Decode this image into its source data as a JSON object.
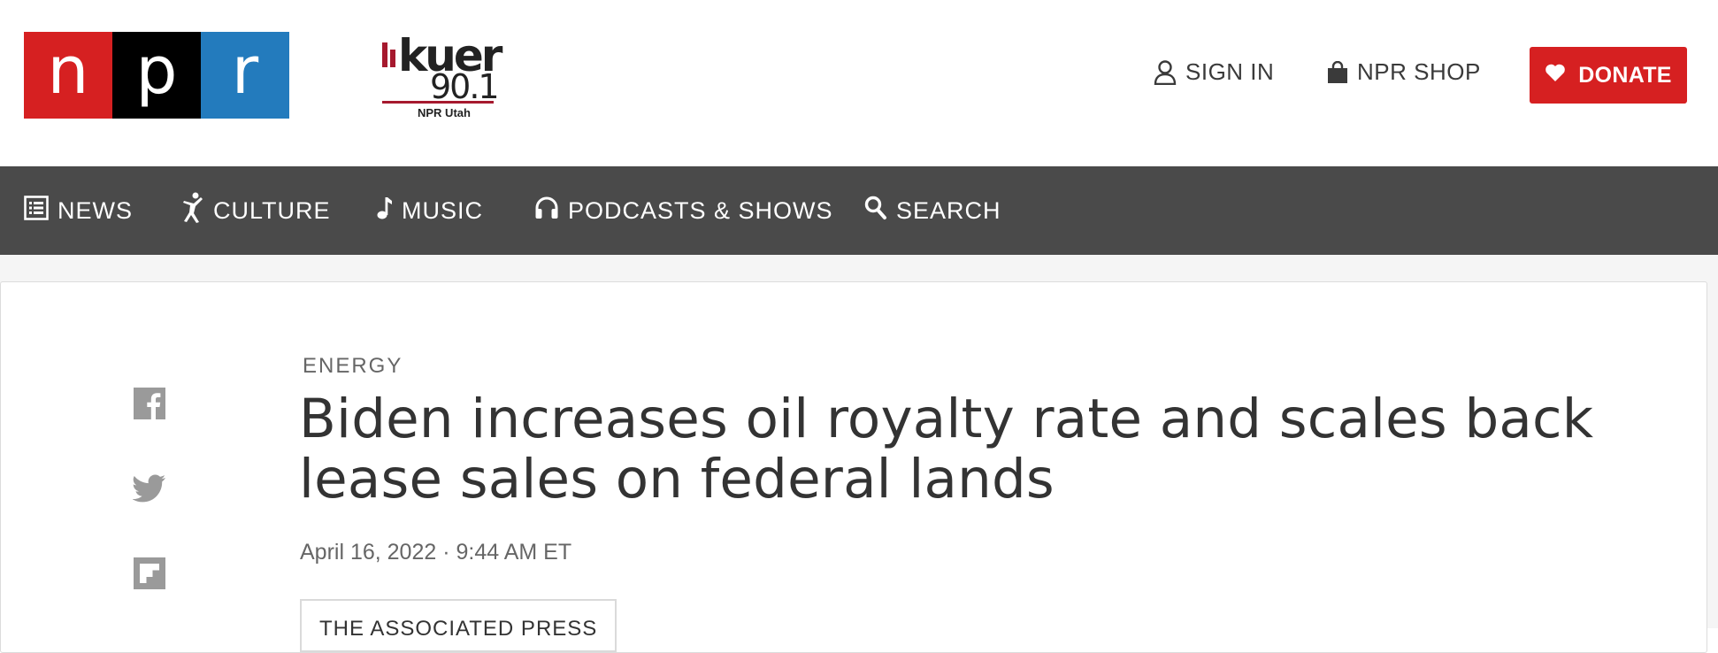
{
  "header": {
    "npr_logo": {
      "letters": [
        "n",
        "p",
        "r"
      ],
      "colors": [
        "#d62021",
        "#000000",
        "#237bbd"
      ]
    },
    "station_logo": {
      "word": "kuer",
      "frequency": "90.1",
      "tagline": "NPR Utah",
      "accent": "#a6192e"
    },
    "sign_in": {
      "label": "SIGN IN",
      "icon": "user-icon"
    },
    "shop": {
      "label": "NPR SHOP",
      "icon": "shopping-bag-icon"
    },
    "donate": {
      "label": "DONATE",
      "icon": "heart-icon",
      "color": "#d62021"
    }
  },
  "nav": {
    "background": "#4a4a4a",
    "items": [
      {
        "label": "NEWS",
        "icon": "news-list-icon"
      },
      {
        "label": "CULTURE",
        "icon": "dancer-icon"
      },
      {
        "label": "MUSIC",
        "icon": "music-note-icon"
      },
      {
        "label": "PODCASTS & SHOWS",
        "icon": "headphones-icon"
      },
      {
        "label": "SEARCH",
        "icon": "search-icon"
      }
    ]
  },
  "share": [
    {
      "icon": "facebook-icon"
    },
    {
      "icon": "twitter-icon"
    },
    {
      "icon": "flipboard-icon"
    }
  ],
  "article": {
    "slug": "ENERGY",
    "headline": "Biden increases oil royalty rate and scales back lease sales on federal lands",
    "date": "April 16, 2022 · 9:44 AM ET",
    "byline": "THE ASSOCIATED PRESS"
  }
}
